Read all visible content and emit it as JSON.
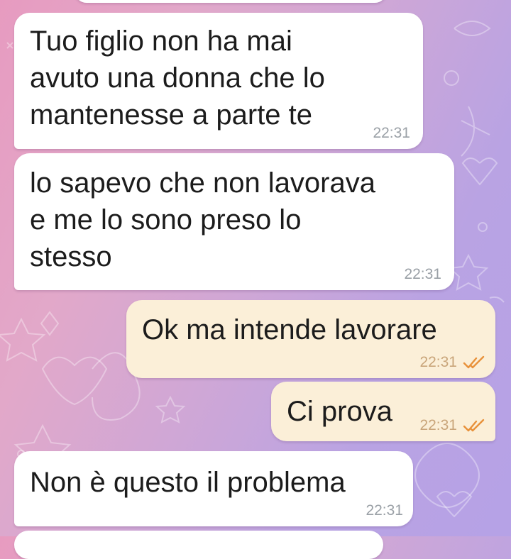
{
  "chat": {
    "messages": [
      {
        "direction": "incoming",
        "text": "Tuo figlio non ha mai\navuto una donna che lo\nmantenesse a parte te",
        "time": "22:31"
      },
      {
        "direction": "incoming",
        "text": "lo sapevo che non lavorava\ne me lo sono preso lo\nstesso",
        "time": "22:31"
      },
      {
        "direction": "outgoing",
        "text": "Ok ma intende lavorare",
        "time": "22:31",
        "status_icon": "double-check-icon"
      },
      {
        "direction": "outgoing",
        "text": "Ci prova",
        "time": "22:31",
        "status_icon": "double-check-icon"
      },
      {
        "direction": "incoming",
        "text": "Non è questo il problema",
        "time": "22:31"
      }
    ]
  },
  "colors": {
    "incoming_bubble": "#ffffff",
    "outgoing_bubble": "#fbefd8",
    "read_tick": "#e8913a",
    "timestamp_incoming": "#9aa0a6",
    "timestamp_outgoing": "#c9a57a"
  }
}
